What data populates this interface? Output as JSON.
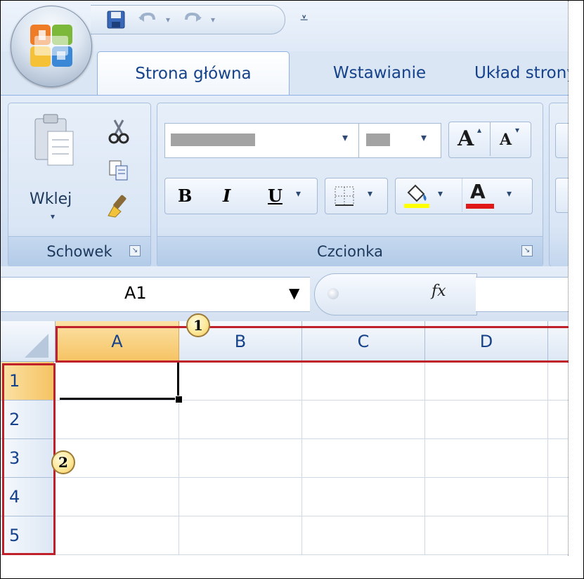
{
  "quick_access": {
    "save_icon": "save-icon",
    "undo_icon": "undo-icon",
    "redo_icon": "redo-icon",
    "customize_icon": "customize-qat-icon"
  },
  "tabs": [
    {
      "label": "Strona główna",
      "active": true
    },
    {
      "label": "Wstawianie",
      "active": false
    },
    {
      "label": "Układ strony",
      "active": false
    }
  ],
  "ribbon": {
    "clipboard": {
      "paste_label": "Wklej",
      "group_label": "Schowek"
    },
    "font": {
      "group_label": "Czcionka",
      "bold": "B",
      "italic": "I",
      "underline": "U",
      "grow_font": "A",
      "shrink_font": "A",
      "font_color_letter": "A",
      "highlight_color": "#ffff00",
      "font_color": "#e01818"
    }
  },
  "formula_bar": {
    "name_box": "A1",
    "fx_label": "fx"
  },
  "sheet": {
    "columns": [
      "A",
      "B",
      "C",
      "D"
    ],
    "rows": [
      "1",
      "2",
      "3",
      "4",
      "5"
    ],
    "selected_cell": "A1"
  },
  "callouts": {
    "columns_callout": "1",
    "rows_callout": "2"
  },
  "colors": {
    "highlight_red": "#c0202a",
    "selected_header": "#f6c363",
    "tab_text": "#15428b"
  }
}
